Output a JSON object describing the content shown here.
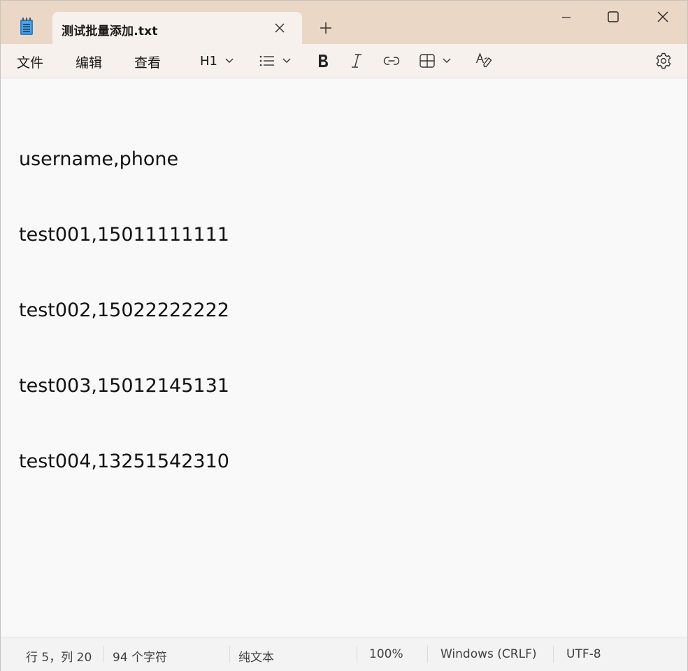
{
  "tab": {
    "title": "测试批量添加.txt"
  },
  "menu": {
    "file": "文件",
    "edit": "编辑",
    "view": "查看"
  },
  "toolbar": {
    "heading": "H1"
  },
  "editor": {
    "lines": [
      "username,phone",
      "test001,15011111111",
      "test002,15022222222",
      "test003,15012145131",
      "test004,13251542310"
    ]
  },
  "status": {
    "position": "行 5，列 20",
    "chars": "94 个字符",
    "format": "纯文本",
    "zoom": "100%",
    "line_ending": "Windows (CRLF)",
    "encoding": "UTF-8"
  },
  "icons": {
    "app": "notepad-icon",
    "tab_close": "close-icon",
    "new_tab": "plus-icon",
    "minimize": "minimize-icon",
    "maximize": "maximize-icon",
    "close": "close-icon",
    "list": "bulleted-list-icon",
    "bold": "bold-icon",
    "italic": "italic-icon",
    "link": "link-icon",
    "table": "table-icon",
    "clear_format": "clear-formatting-icon",
    "settings": "gear-icon"
  },
  "colors": {
    "titlebar": "#ead7c5",
    "tab": "#f6f1ec",
    "editor": "#f9f9f9"
  }
}
